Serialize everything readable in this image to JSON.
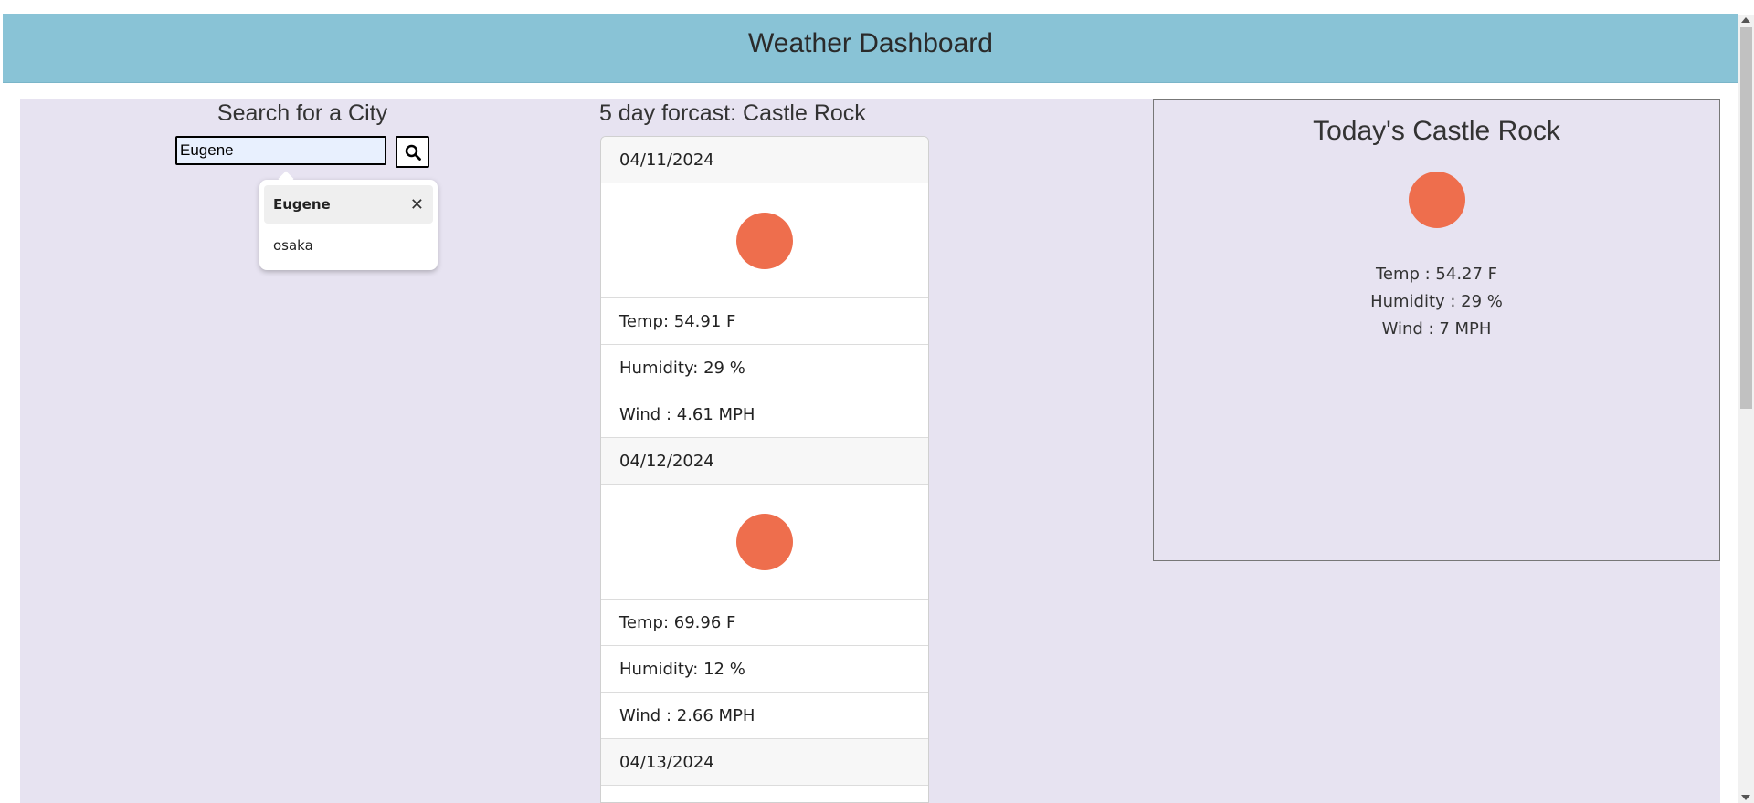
{
  "header": {
    "title": "Weather Dashboard"
  },
  "search": {
    "title": "Search for a City",
    "input_value": "Eugene",
    "button_icon": "search-icon",
    "suggestions": [
      {
        "label": "Eugene",
        "removable": true
      },
      {
        "label": "osaka"
      }
    ]
  },
  "forecast": {
    "title": "5 day forcast: Castle Rock",
    "days": [
      {
        "date": "04/11/2024",
        "icon": "sun-icon",
        "temp": "Temp: 54.91 F",
        "humidity": "Humidity: 29 %",
        "wind": "Wind : 4.61 MPH"
      },
      {
        "date": "04/12/2024",
        "icon": "sun-icon",
        "temp": "Temp: 69.96 F",
        "humidity": "Humidity: 12 %",
        "wind": "Wind : 2.66 MPH"
      },
      {
        "date": "04/13/2024"
      }
    ]
  },
  "today": {
    "title": "Today's Castle Rock",
    "icon": "sun-icon",
    "temp": "Temp : 54.27 F",
    "humidity": "Humidity : 29 %",
    "wind": "Wind : 7 MPH"
  },
  "colors": {
    "header_bg": "#89c3d6",
    "page_bg": "#e7e3f1",
    "sun": "#ee6e4d"
  }
}
